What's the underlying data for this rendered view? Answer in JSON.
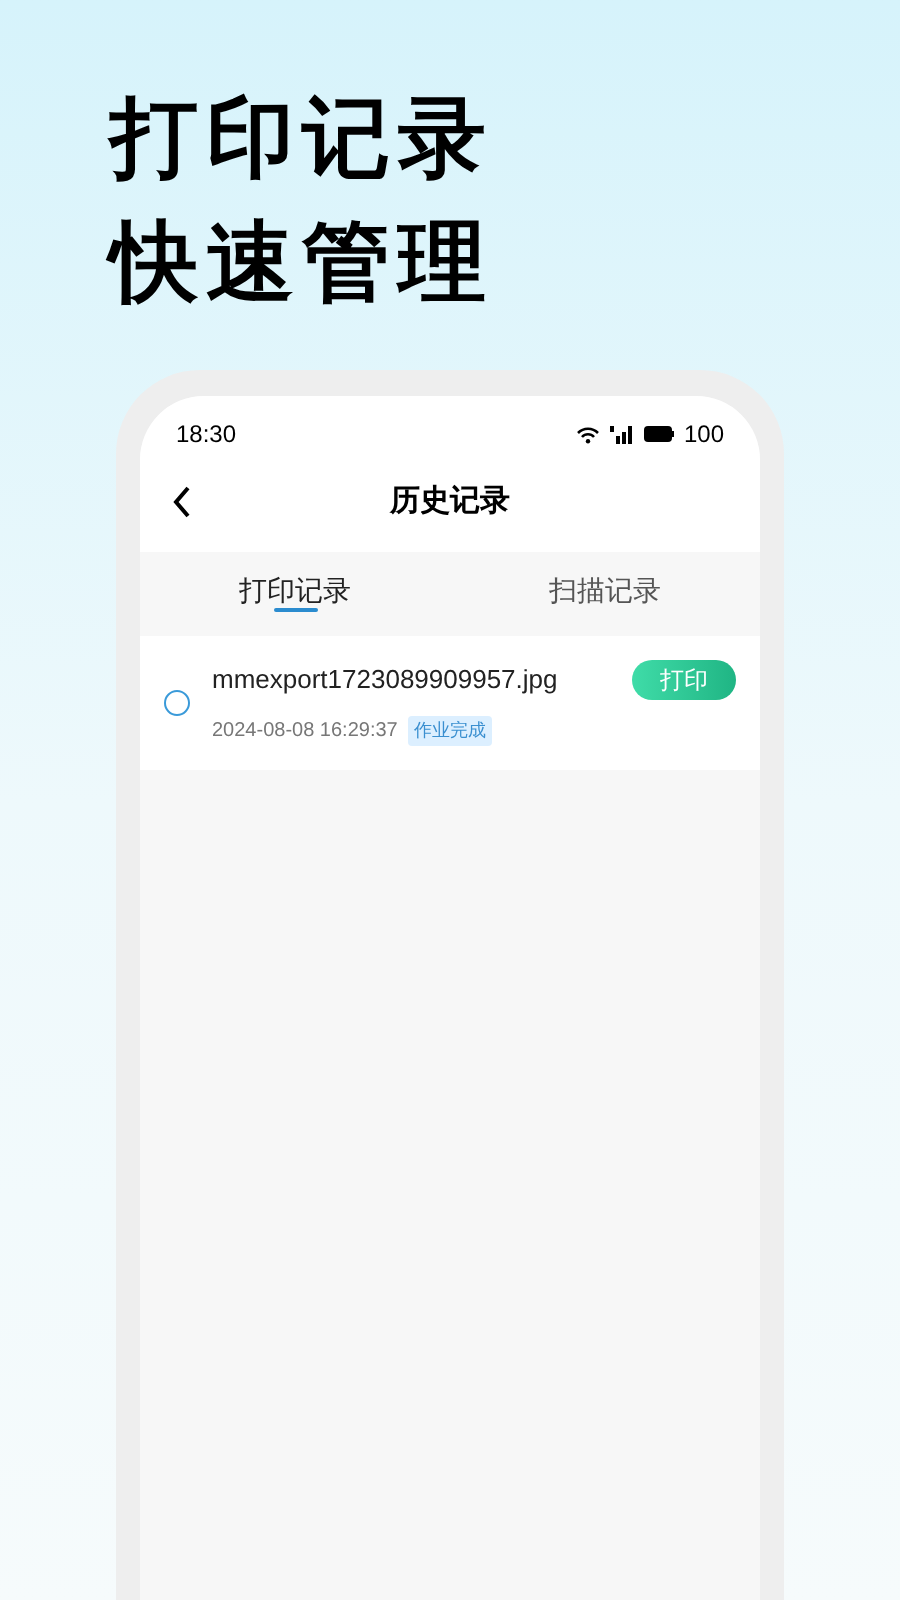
{
  "headline": [
    "打印记录",
    "快速管理"
  ],
  "status_bar": {
    "time": "18:30",
    "battery": "100"
  },
  "header": {
    "title": "历史记录"
  },
  "tabs": [
    {
      "label": "打印记录",
      "selected": true
    },
    {
      "label": "扫描记录",
      "selected": false
    }
  ],
  "records": [
    {
      "file": "mmexport1723089909957.jpg",
      "time": "2024-08-08 16:29:37",
      "status": "作业完成",
      "checked": false,
      "action": "打印"
    }
  ]
}
